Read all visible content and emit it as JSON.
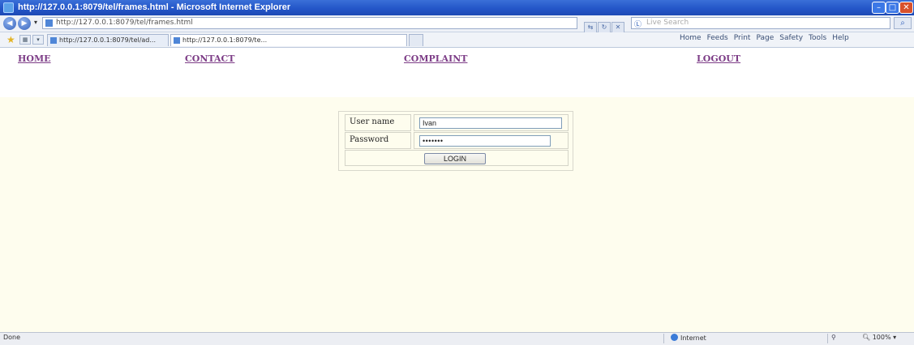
{
  "window": {
    "title": "http://127.0.0.1:8079/tel/frames.html - Microsoft Internet Explorer",
    "minimize_glyph": "–",
    "maximize_glyph": "□",
    "close_glyph": "✕"
  },
  "address_bar": {
    "url": "http://127.0.0.1:8079/tel/frames.html",
    "search_placeholder": "Live Search",
    "back_glyph": "◀",
    "forward_glyph": "▶",
    "dropdown_glyph": "▾",
    "go_glyph": "⇆",
    "refresh_glyph": "↻",
    "stop_glyph": "✕",
    "search_logo": "Ⓛ",
    "search_go_glyph": "⌕"
  },
  "tabs": {
    "favorites_glyph": "★",
    "quick_tabs_glyph": "▦",
    "tab_list_glyph": "▾",
    "items": [
      {
        "label": "http://127.0.0.1:8079/tel/ad..."
      },
      {
        "label": "http://127.0.0.1:8079/te..."
      }
    ],
    "toolbar": [
      "Home",
      "Feeds",
      "Print",
      "Page",
      "Safety",
      "Tools",
      "Help"
    ]
  },
  "page": {
    "nav": [
      "HOME",
      "CONTACT",
      "COMPLAINT",
      "LOGOUT"
    ],
    "login": {
      "username_label": "User name",
      "username_value": "Ivan",
      "password_label": "Password",
      "password_value": "•••••••",
      "button_label": "LOGIN"
    }
  },
  "status_bar": {
    "text": "Done",
    "zone": "Internet",
    "protected_glyph": "⚲",
    "zoom": "100%"
  },
  "colors": {
    "title_bar": "#2456c8",
    "page_background": "#fefdee",
    "nav_link": "#7d3d87"
  }
}
